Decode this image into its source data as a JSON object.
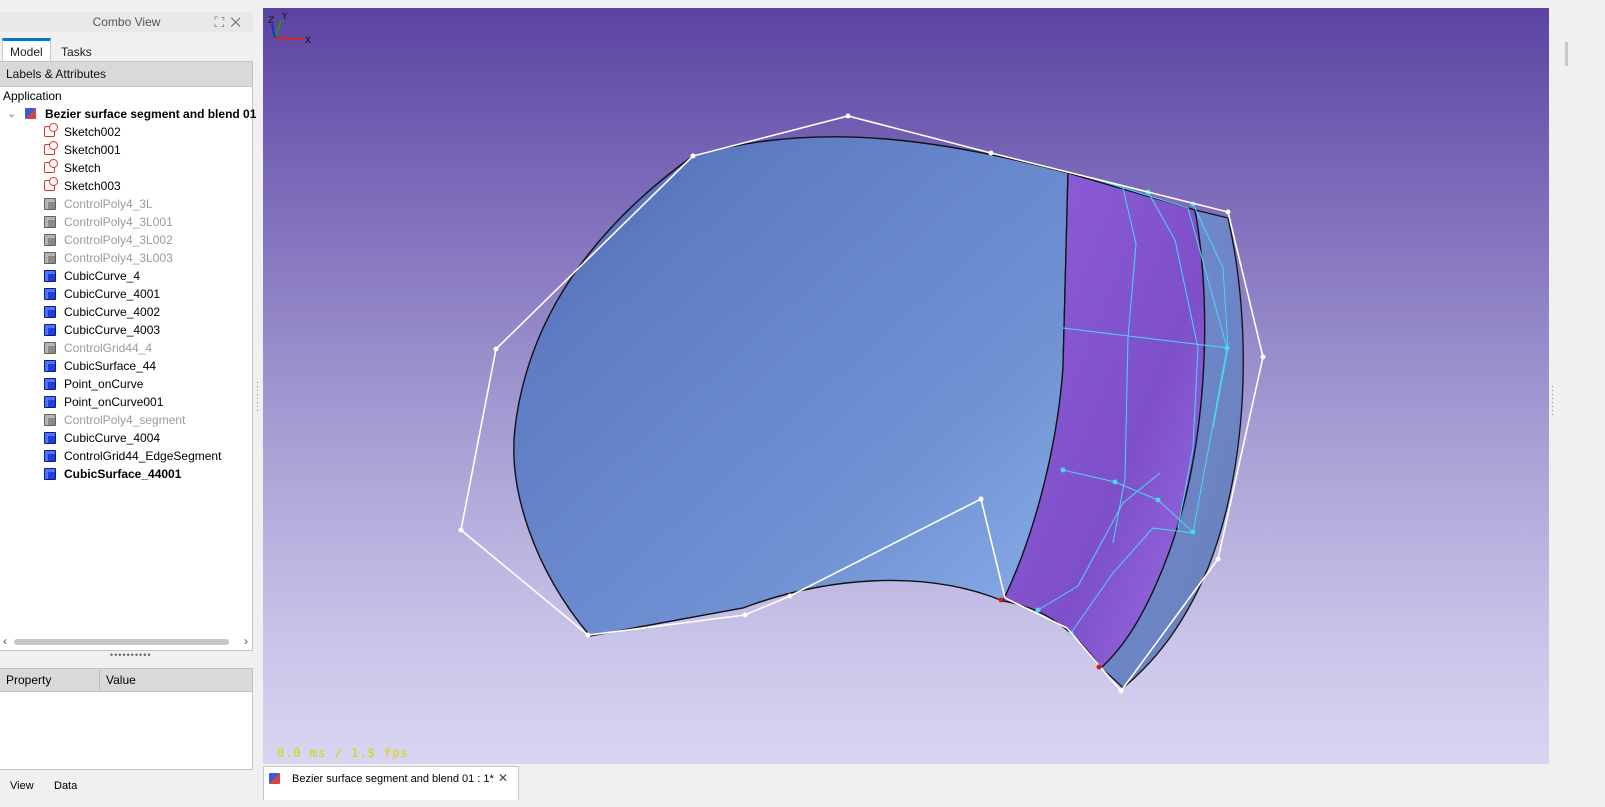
{
  "combo": {
    "title": "Combo View",
    "tabs": [
      "Model",
      "Tasks"
    ]
  },
  "tree": {
    "header": "Labels & Attributes",
    "app_label": "Application",
    "document": "Bezier surface segment and blend 01",
    "items": [
      {
        "label": "Sketch002",
        "icon": "sketch",
        "style": "normal"
      },
      {
        "label": "Sketch001",
        "icon": "sketch",
        "style": "normal"
      },
      {
        "label": "Sketch",
        "icon": "sketch",
        "style": "normal"
      },
      {
        "label": "Sketch003",
        "icon": "sketch",
        "style": "normal"
      },
      {
        "label": "ControlPoly4_3L",
        "icon": "gray-cube",
        "style": "dim"
      },
      {
        "label": "ControlPoly4_3L001",
        "icon": "gray-cube",
        "style": "dim"
      },
      {
        "label": "ControlPoly4_3L002",
        "icon": "gray-cube",
        "style": "dim"
      },
      {
        "label": "ControlPoly4_3L003",
        "icon": "gray-cube",
        "style": "dim"
      },
      {
        "label": "CubicCurve_4",
        "icon": "blue-cube",
        "style": "normal"
      },
      {
        "label": "CubicCurve_4001",
        "icon": "blue-cube",
        "style": "normal"
      },
      {
        "label": "CubicCurve_4002",
        "icon": "blue-cube",
        "style": "normal"
      },
      {
        "label": "CubicCurve_4003",
        "icon": "blue-cube",
        "style": "normal"
      },
      {
        "label": "ControlGrid44_4",
        "icon": "gray-cube",
        "style": "dim"
      },
      {
        "label": "CubicSurface_44",
        "icon": "blue-cube",
        "style": "normal"
      },
      {
        "label": "Point_onCurve",
        "icon": "blue-cube",
        "style": "normal"
      },
      {
        "label": "Point_onCurve001",
        "icon": "blue-cube",
        "style": "normal"
      },
      {
        "label": "ControlPoly4_segment",
        "icon": "gray-cube",
        "style": "dim"
      },
      {
        "label": "CubicCurve_4004",
        "icon": "blue-cube",
        "style": "normal"
      },
      {
        "label": "ControlGrid44_EdgeSegment",
        "icon": "blue-cube",
        "style": "normal"
      },
      {
        "label": "CubicSurface_44001",
        "icon": "blue-cube",
        "style": "bold"
      }
    ]
  },
  "property": {
    "col_property": "Property",
    "col_value": "Value"
  },
  "bottom_tabs": [
    "View",
    "Data"
  ],
  "viewport": {
    "fps": "0.0 ms / 1.$ fps",
    "axis": {
      "x": "X",
      "y": "Y",
      "z": "Z"
    }
  },
  "doc_tab": {
    "label": "Bezier surface segment and blend 01 : 1*"
  },
  "colors": {
    "surface_main": "#6f8dd0",
    "surface_blend": "#8b63d9",
    "control_lines": "#ffffff",
    "control_grid": "#49d9f0",
    "viewport_top": "#5b44a1",
    "viewport_bottom": "#d8d5f1"
  }
}
